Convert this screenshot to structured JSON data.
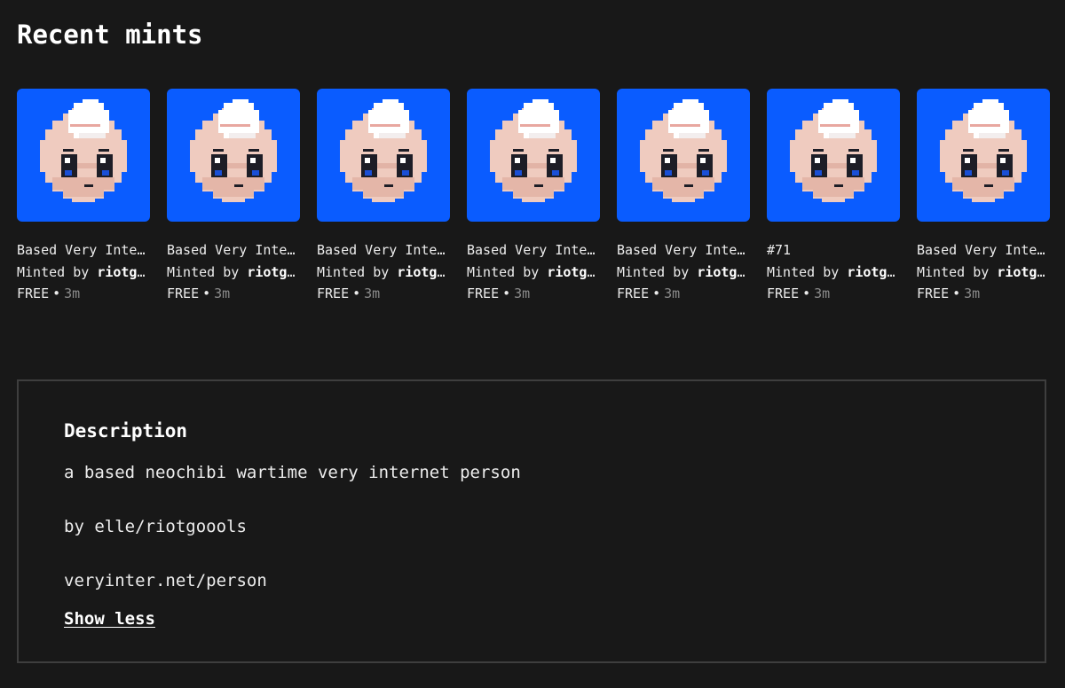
{
  "page": {
    "title": "Recent mints"
  },
  "mints": [
    {
      "name": "Based Very Internet Person",
      "minted_by_prefix": "Minted by",
      "minter": "riotgoools",
      "price": "FREE",
      "separator": "•",
      "age": "3m",
      "image_icon": "chibi-avatar-icon"
    },
    {
      "name": "Based Very Internet Person",
      "minted_by_prefix": "Minted by",
      "minter": "riotgoools",
      "price": "FREE",
      "separator": "•",
      "age": "3m",
      "image_icon": "chibi-avatar-icon"
    },
    {
      "name": "Based Very Internet Person",
      "minted_by_prefix": "Minted by",
      "minter": "riotgoools",
      "price": "FREE",
      "separator": "•",
      "age": "3m",
      "image_icon": "chibi-avatar-icon"
    },
    {
      "name": "Based Very Internet Person",
      "minted_by_prefix": "Minted by",
      "minter": "riotgoools",
      "price": "FREE",
      "separator": "•",
      "age": "3m",
      "image_icon": "chibi-avatar-icon"
    },
    {
      "name": "Based Very Internet Person",
      "minted_by_prefix": "Minted by",
      "minter": "riotgoools",
      "price": "FREE",
      "separator": "•",
      "age": "3m",
      "image_icon": "chibi-avatar-icon"
    },
    {
      "name": "#71",
      "minted_by_prefix": "Minted by",
      "minter": "riotgoools",
      "price": "FREE",
      "separator": "•",
      "age": "3m",
      "image_icon": "chibi-avatar-icon"
    },
    {
      "name": "Based Very Internet Person",
      "minted_by_prefix": "Minted by",
      "minter": "riotgoools",
      "price": "FREE",
      "separator": "•",
      "age": "3m",
      "image_icon": "chibi-avatar-icon"
    }
  ],
  "description": {
    "heading": "Description",
    "lines": [
      "a based neochibi wartime very internet person",
      "by elle/riotgoools",
      "veryinter.net/person"
    ],
    "toggle_label": "Show less"
  },
  "colors": {
    "background": "#181818",
    "thumb_background": "#0a5cff",
    "border": "#3e3e3e",
    "muted_text": "#8a8a8a"
  }
}
